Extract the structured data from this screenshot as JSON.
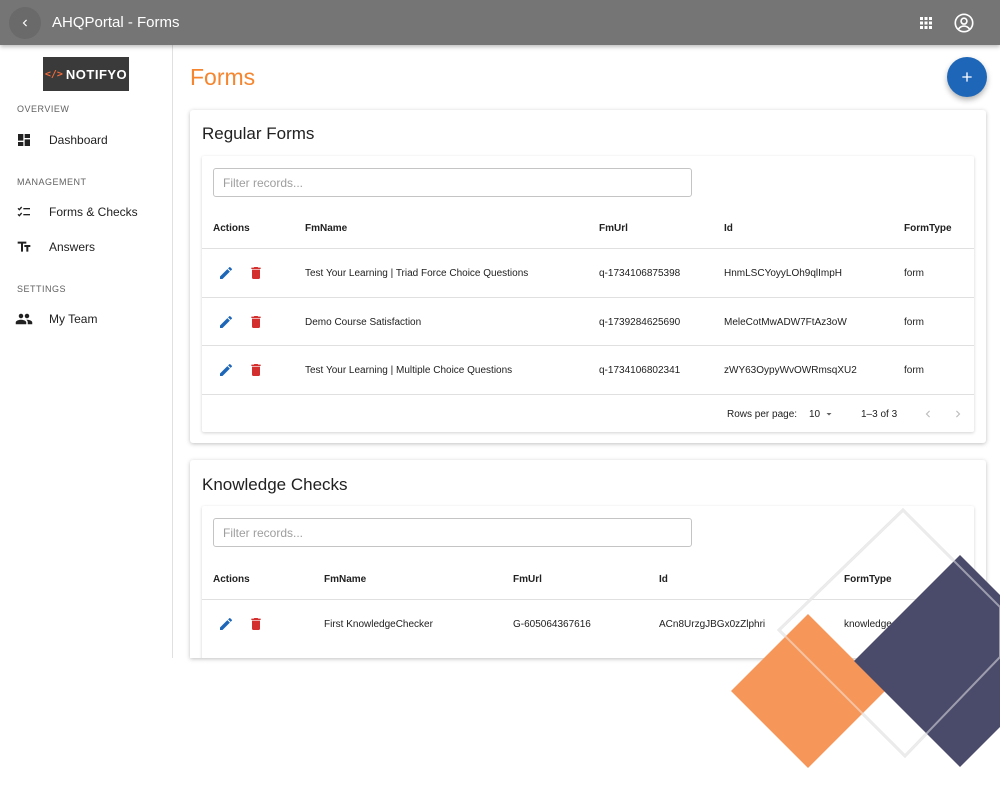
{
  "appbar": {
    "title": "AHQPortal - Forms",
    "icons": [
      "chevron-left-icon",
      "apps-grid-icon",
      "account-circle-icon"
    ],
    "color": "#757575"
  },
  "sidebar": {
    "logo_text": "NOTIFYO",
    "logo_mark": "</>",
    "sections": [
      {
        "label": "OVERVIEW",
        "items": [
          {
            "label": "Dashboard",
            "icon": "dashboard-icon"
          }
        ]
      },
      {
        "label": "MANAGEMENT",
        "items": [
          {
            "label": "Forms & Checks",
            "icon": "checklist-icon"
          },
          {
            "label": "Answers",
            "icon": "text-fields-icon"
          }
        ]
      },
      {
        "label": "SETTINGS",
        "items": [
          {
            "label": "My Team",
            "icon": "people-icon"
          }
        ]
      }
    ]
  },
  "main": {
    "page_title": "Forms",
    "fab_icon": "plus-icon",
    "accent": "#f5862f",
    "fab_color": "#1e67b8"
  },
  "regular_forms": {
    "title": "Regular Forms",
    "filter_placeholder": "Filter records...",
    "columns": [
      "Actions",
      "FmName",
      "FmUrl",
      "Id",
      "FormType"
    ],
    "rows": [
      {
        "name": "Test Your Learning | Triad Force Choice Questions",
        "url": "q-1734106875398",
        "id": "HnmLSCYoyyLOh9qlImpH",
        "type": "form"
      },
      {
        "name": "Demo Course Satisfaction",
        "url": "q-1739284625690",
        "id": "MeleCotMwADW7FtAz3oW",
        "type": "form"
      },
      {
        "name": "Test Your Learning | Multiple Choice Questions",
        "url": "q-1734106802341",
        "id": "zWY63OypyWvOWRmsqXU2",
        "type": "form"
      }
    ],
    "pagination": {
      "rows_per_page_label": "Rows per page:",
      "rows_per_page": "10",
      "range": "1–3 of 3"
    }
  },
  "knowledge_checks": {
    "title": "Knowledge Checks",
    "filter_placeholder": "Filter records...",
    "columns": [
      "Actions",
      "FmName",
      "FmUrl",
      "Id",
      "FormType"
    ],
    "rows": [
      {
        "name": "First KnowledgeChecker",
        "url": "G-605064367616",
        "id": "ACn8UrzgJBGx0zZlphri",
        "type": "knowledgecheck"
      }
    ]
  },
  "colors": {
    "edit_icon": "#1e67b8",
    "delete_icon": "#d32f2f",
    "deco_orange": "#f79659",
    "deco_navy": "#4a4a6b"
  }
}
